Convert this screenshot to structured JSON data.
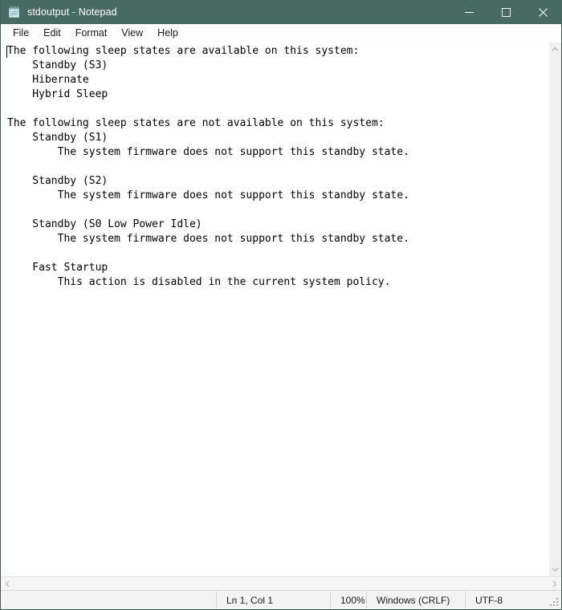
{
  "window": {
    "title": "stdoutput - Notepad",
    "icon": "notepad-icon",
    "accent_titlebar_color": "#476a61",
    "titlebar_text_color": "#ffffff",
    "controls": [
      {
        "name": "minimize",
        "label": "—"
      },
      {
        "name": "maximize",
        "label": "□"
      },
      {
        "name": "close",
        "label": "✕"
      }
    ]
  },
  "menu": {
    "items": [
      {
        "label": "File"
      },
      {
        "label": "Edit"
      },
      {
        "label": "Format"
      },
      {
        "label": "View"
      },
      {
        "label": "Help"
      }
    ]
  },
  "editor": {
    "text": "The following sleep states are available on this system:\n    Standby (S3)\n    Hibernate\n    Hybrid Sleep\n\nThe following sleep states are not available on this system:\n    Standby (S1)\n        The system firmware does not support this standby state.\n\n    Standby (S2)\n        The system firmware does not support this standby state.\n\n    Standby (S0 Low Power Idle)\n        The system firmware does not support this standby state.\n\n    Fast Startup\n        This action is disabled in the current system policy.",
    "lines": [
      "The following sleep states are available on this system:",
      "    Standby (S3)",
      "    Hibernate",
      "    Hybrid Sleep",
      "",
      "The following sleep states are not available on this system:",
      "    Standby (S1)",
      "        The system firmware does not support this standby state.",
      "",
      "    Standby (S2)",
      "        The system firmware does not support this standby state.",
      "",
      "    Standby (S0 Low Power Idle)",
      "        The system firmware does not support this standby state.",
      "",
      "    Fast Startup",
      "        This action is disabled in the current system policy."
    ],
    "background_color": "#ffffff",
    "text_color": "#000000"
  },
  "scrollbars": {
    "vertical": {
      "up_icon": "chevron-up-icon",
      "down_icon": "chevron-down-icon"
    },
    "horizontal": {
      "left_icon": "chevron-left-icon",
      "right_icon": "chevron-right-icon"
    }
  },
  "status_bar": {
    "cursor_position": "Ln 1, Col 1",
    "zoom": "100%",
    "line_ending": "Windows (CRLF)",
    "encoding": "UTF-8"
  }
}
